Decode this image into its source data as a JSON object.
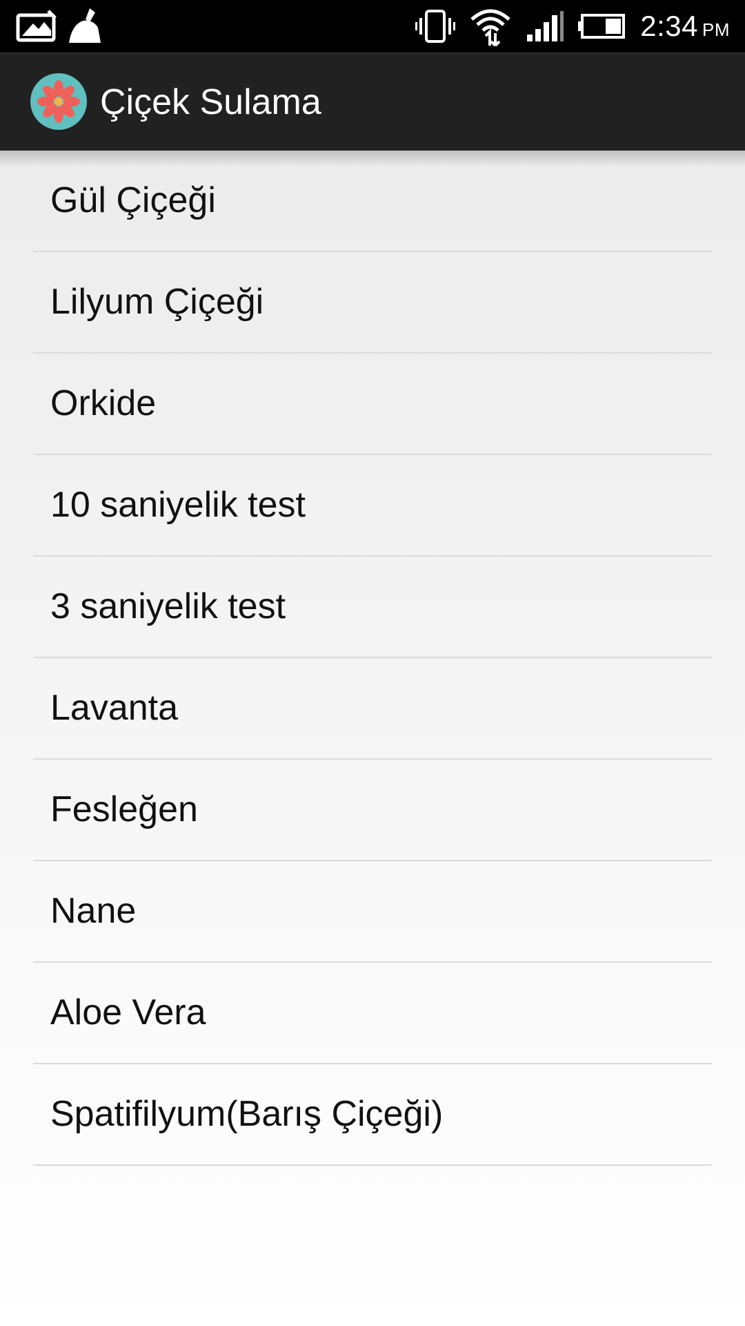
{
  "status_bar": {
    "time": "2:34",
    "ampm": "PM",
    "icons": [
      "photo-icon",
      "cleaner-icon",
      "vibrate-icon",
      "wifi-icon",
      "signal-icon",
      "battery-icon"
    ]
  },
  "action_bar": {
    "title": "Çiçek Sulama",
    "app_icon": "flower-icon",
    "background": "#212121"
  },
  "flowers": [
    {
      "label": "Gül Çiçeği"
    },
    {
      "label": "Lilyum Çiçeği"
    },
    {
      "label": "Orkide"
    },
    {
      "label": "10 saniyelik test"
    },
    {
      "label": "3 saniyelik test"
    },
    {
      "label": "Lavanta"
    },
    {
      "label": "Fesleğen"
    },
    {
      "label": "Nane"
    },
    {
      "label": "Aloe Vera"
    },
    {
      "label": "Spatifilyum(Barış Çiçeği)"
    }
  ]
}
